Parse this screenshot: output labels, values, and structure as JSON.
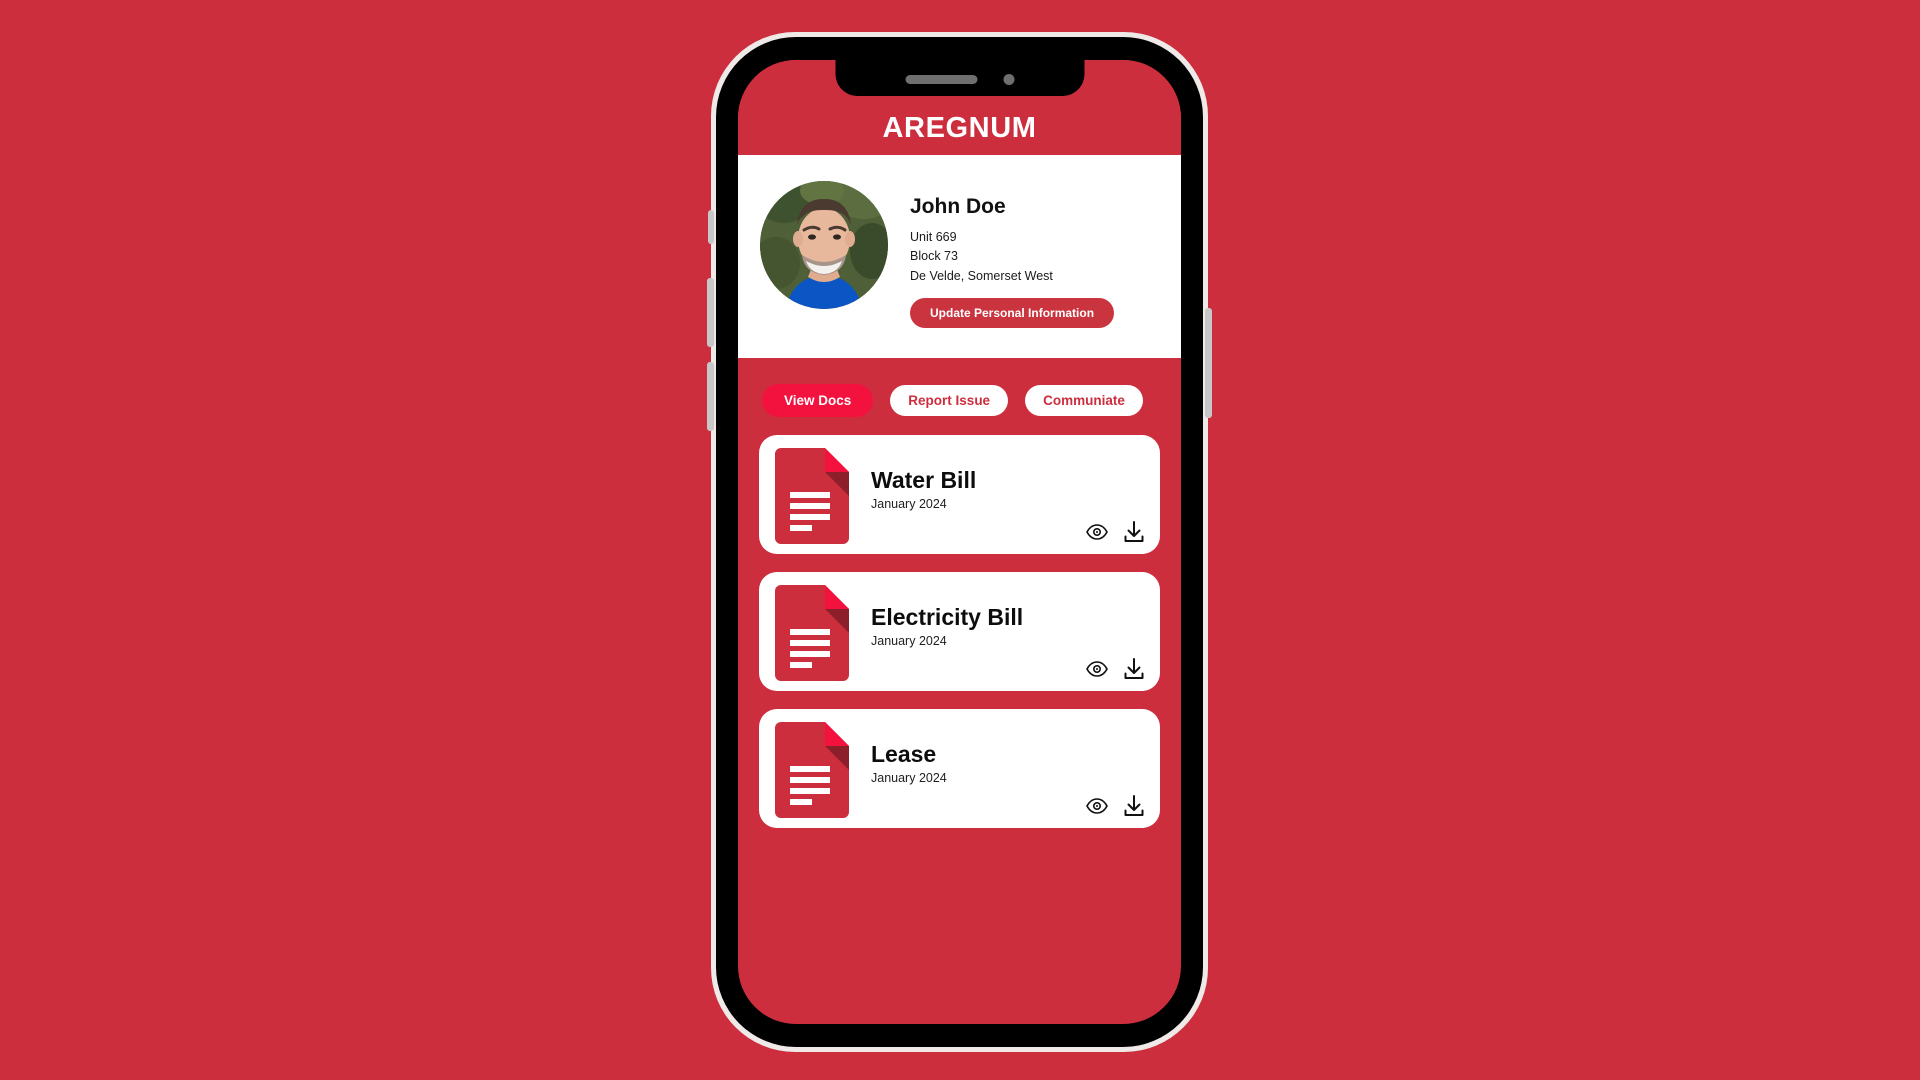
{
  "colors": {
    "background_red": "#cc2e3e",
    "header_red": "#cc2e3e",
    "active_tab_red": "#f3123e",
    "update_button_red": "#c9343f",
    "card_white": "#ffffff",
    "bezel_black": "#000000",
    "side_button_gray": "#c7c7c7",
    "doc_icon_red": "#cc2e3e",
    "doc_icon_fold_bright": "#f3123e",
    "doc_icon_fold_shadow": "#8c1f2a"
  },
  "device": {
    "notch": {
      "speaker_icon": "speaker-grille-icon",
      "camera_icon": "front-camera-icon"
    },
    "buttons": [
      {
        "name": "silent-switch"
      },
      {
        "name": "volume-up-button"
      },
      {
        "name": "volume-down-button"
      },
      {
        "name": "power-button"
      }
    ]
  },
  "app": {
    "header": {
      "title": "AREGNUM"
    },
    "profile": {
      "avatar_alt": "user-avatar-photo",
      "name": "John Doe",
      "address_lines": [
        "Unit 669",
        "Block 73",
        "De Velde, Somerset West"
      ],
      "update_button_label": "Update Personal Information"
    },
    "tabs": [
      {
        "label": "View Docs",
        "active": true
      },
      {
        "label": "Report Issue",
        "active": false
      },
      {
        "label": "Communiate",
        "active": false
      }
    ],
    "documents": [
      {
        "title": "Water Bill",
        "date": "January 2024",
        "file_icon": "document-file-icon",
        "view_label": "view",
        "download_label": "download"
      },
      {
        "title": "Electricity Bill",
        "date": "January 2024",
        "file_icon": "document-file-icon",
        "view_label": "view",
        "download_label": "download"
      },
      {
        "title": "Lease",
        "date": "January 2024",
        "file_icon": "document-file-icon",
        "view_label": "view",
        "download_label": "download"
      }
    ]
  }
}
